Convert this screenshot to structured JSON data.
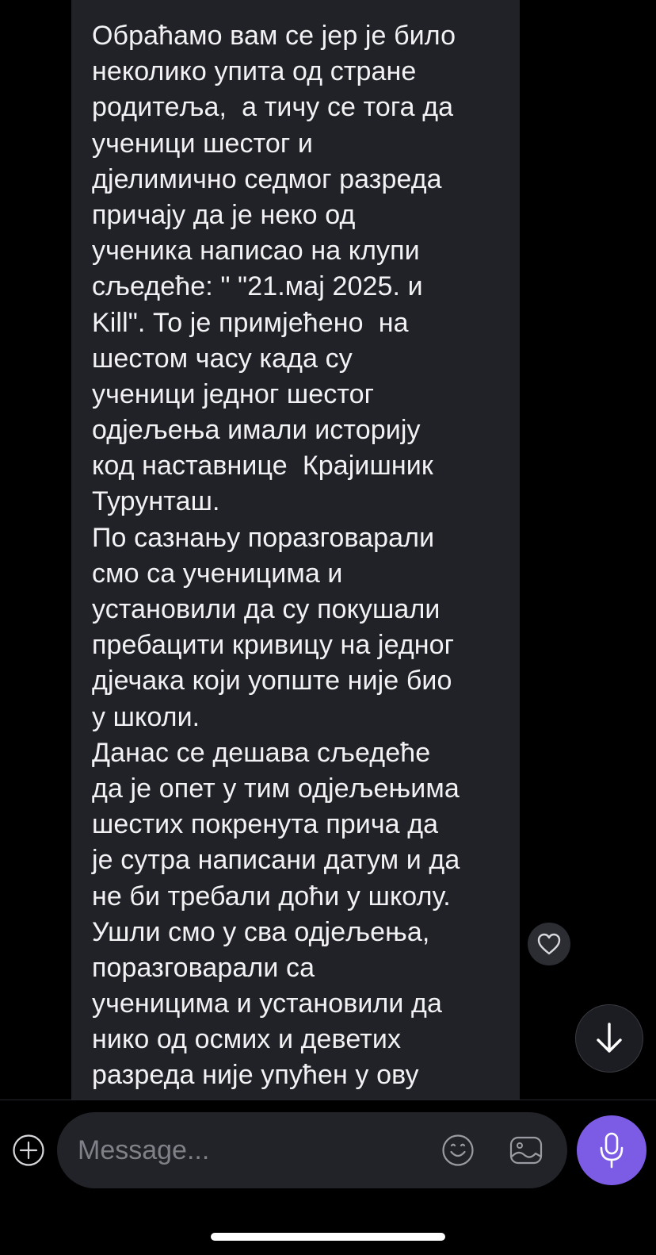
{
  "message": {
    "lines": [
      "Обраћамо вам се јер је било",
      "неколико упита од стране",
      "родитеља,  а тичу се тога да",
      "ученици шестог и",
      "дјелимично седмог разреда",
      "причају да је неко од",
      "ученика написао на клупи",
      "сљедеће: \" \"21.мај 2025. и",
      "Kill\". То је примјећено  на",
      "шестом часу када су",
      "ученици једног шестог",
      "одјељења имали историју",
      "код наставнице  Крајишник",
      "Турунташ.",
      "По сазнању поразговарали",
      "смо са ученицима и",
      "установили да су покушали",
      "пребацити кривицу на једног",
      "дјечака који уопште није био",
      "у школи.",
      "Данас се дешава сљедеће",
      "да је опет у тим одјељењима",
      "шестих покренута прича да",
      "је сутра написани датум и да",
      "не би требали доћи у школу.",
      "Ушли смо у сва одјељења,",
      "поразговарали са",
      "ученицима и установили да",
      "нико од осмих и деветих",
      "разреда није упућен у ову"
    ]
  },
  "composer": {
    "placeholder": "Message...",
    "value": ""
  },
  "icons": {
    "add": "plus-circle-icon",
    "emoji": "smiley-icon",
    "media": "image-sticker-icon",
    "voice": "microphone-icon",
    "like": "heart-icon",
    "scroll": "arrow-down-icon"
  },
  "colors": {
    "background": "#000000",
    "bubble": "#212227",
    "text": "#f2f2f4",
    "placeholder": "#7f8088",
    "accent": "#7c5ce5"
  }
}
